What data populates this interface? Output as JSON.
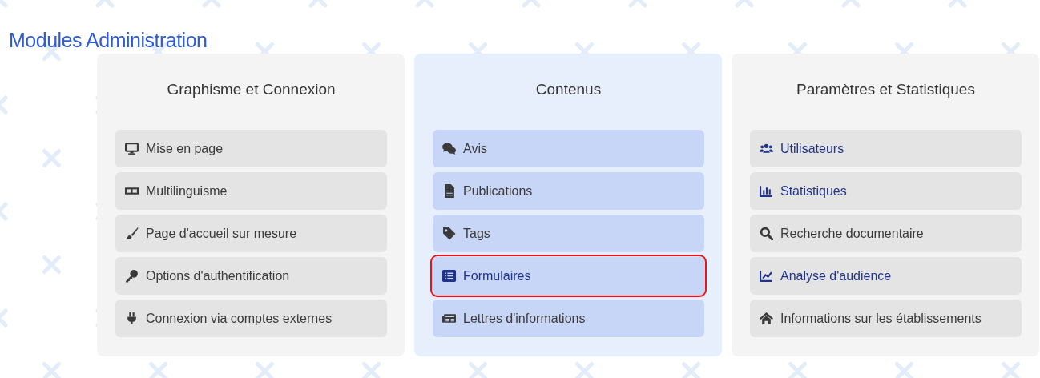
{
  "title": "Modules Administration",
  "panels": [
    {
      "title": "Graphisme et Connexion",
      "selected": false,
      "items": [
        {
          "label": "Mise en page",
          "highlighted": false,
          "selected": false
        },
        {
          "label": "Multilinguisme",
          "highlighted": false,
          "selected": false
        },
        {
          "label": "Page d'accueil sur mesure",
          "highlighted": false,
          "selected": false
        },
        {
          "label": "Options d'authentification",
          "highlighted": false,
          "selected": false
        },
        {
          "label": "Connexion via comptes externes",
          "highlighted": false,
          "selected": false
        }
      ]
    },
    {
      "title": "Contenus",
      "selected": true,
      "items": [
        {
          "label": "Avis",
          "highlighted": false,
          "selected": false
        },
        {
          "label": "Publications",
          "highlighted": false,
          "selected": false
        },
        {
          "label": "Tags",
          "highlighted": false,
          "selected": false
        },
        {
          "label": "Formulaires",
          "highlighted": true,
          "selected": true
        },
        {
          "label": "Lettres d'informations",
          "highlighted": false,
          "selected": false
        }
      ]
    },
    {
      "title": "Paramètres et Statistiques",
      "selected": false,
      "items": [
        {
          "label": "Utilisateurs",
          "highlighted": true,
          "selected": false
        },
        {
          "label": "Statistiques",
          "highlighted": true,
          "selected": false
        },
        {
          "label": "Recherche documentaire",
          "highlighted": false,
          "selected": false
        },
        {
          "label": "Analyse d'audience",
          "highlighted": true,
          "selected": false
        },
        {
          "label": "Informations sur les établissements",
          "highlighted": false,
          "selected": false
        }
      ]
    }
  ]
}
